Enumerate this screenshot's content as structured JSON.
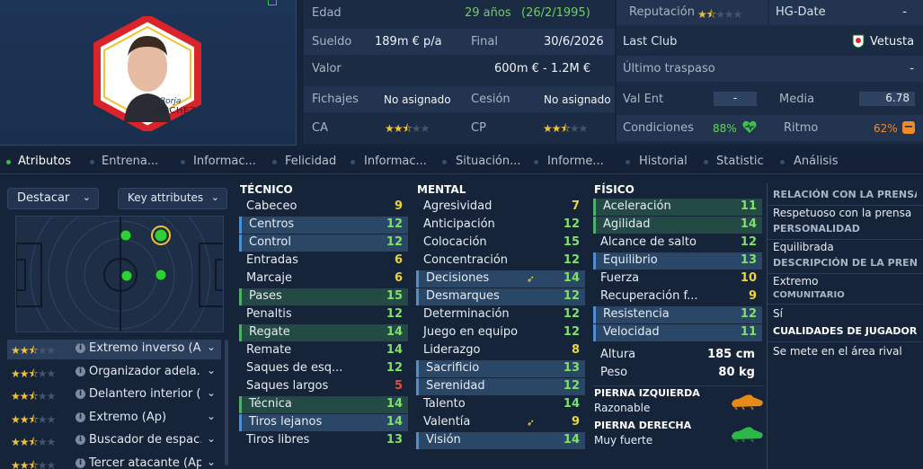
{
  "player": {
    "badge_first": "Borja",
    "badge_last": "SÁNCHEZ"
  },
  "info": {
    "edad_label": "Edad",
    "edad_value": "29 años",
    "birth": "(26/2/1995)",
    "sueldo_label": "Sueldo",
    "sueldo_value": "189m € p/a",
    "final_label": "Final",
    "final_value": "30/6/2026",
    "valor_label": "Valor",
    "valor_value": "600m € - 1.2M €",
    "fichajes_label": "Fichajes",
    "fichajes_value": "No asignado",
    "cesion_label": "Cesión",
    "cesion_value": "No asignado",
    "ca_label": "CA",
    "cp_label": "CP",
    "ca_stars": 2.5,
    "cp_stars": 2.5
  },
  "info2": {
    "reputacion_label": "Reputación",
    "reputacion_stars": 1.5,
    "hg_label": "HG-Date",
    "hg_value": "-",
    "lastclub_label": "Last Club",
    "lastclub_value": "Vetusta",
    "traspaso_label": "Último traspaso",
    "traspaso_value": "-",
    "valent_label": "Val Ent",
    "valent_value": "-",
    "media_label": "Media",
    "media_value": "6.78",
    "condiciones_label": "Condiciones",
    "condiciones_value": "88%",
    "ritmo_label": "Ritmo",
    "ritmo_value": "62%"
  },
  "tabs": [
    "Atributos",
    "Entrena...",
    "Informac...",
    "Felicidad",
    "Informac...",
    "Situación...",
    "Informe...",
    "Historial",
    "Statistic",
    "Análisis"
  ],
  "left": {
    "destacar": "Destacar",
    "key_attributes": "Key attributes",
    "roles": [
      {
        "name": "Extremo inverso (Ap)",
        "stars": 2.5
      },
      {
        "name": "Organizador adela...",
        "stars": 2.5
      },
      {
        "name": "Delantero interior (...",
        "stars": 2.5
      },
      {
        "name": "Extremo (Ap)",
        "stars": 2.5
      },
      {
        "name": "Buscador de espac...",
        "stars": 2.5
      },
      {
        "name": "Tercer atacante (Ap)",
        "stars": 2.5
      }
    ]
  },
  "tecnico": {
    "title": "TÉCNICO",
    "rows": [
      {
        "n": "Cabeceo",
        "v": "9",
        "c": "yellow",
        "hl": false
      },
      {
        "n": "Centros",
        "v": "12",
        "c": "green",
        "hl": true
      },
      {
        "n": "Control",
        "v": "12",
        "c": "green",
        "hl": true
      },
      {
        "n": "Entradas",
        "v": "6",
        "c": "yellow",
        "hl": false
      },
      {
        "n": "Marcaje",
        "v": "6",
        "c": "yellow",
        "hl": false
      },
      {
        "n": "Pases",
        "v": "15",
        "c": "green",
        "hl": "g"
      },
      {
        "n": "Penaltis",
        "v": "12",
        "c": "green",
        "hl": false
      },
      {
        "n": "Regate",
        "v": "14",
        "c": "green",
        "hl": "g"
      },
      {
        "n": "Remate",
        "v": "14",
        "c": "green",
        "hl": false
      },
      {
        "n": "Saques de esq...",
        "v": "12",
        "c": "green",
        "hl": false
      },
      {
        "n": "Saques largos",
        "v": "5",
        "c": "red",
        "hl": false
      },
      {
        "n": "Técnica",
        "v": "14",
        "c": "green",
        "hl": "g"
      },
      {
        "n": "Tiros lejanos",
        "v": "14",
        "c": "green",
        "hl": true
      },
      {
        "n": "Tiros libres",
        "v": "13",
        "c": "green",
        "hl": false
      }
    ]
  },
  "mental": {
    "title": "MENTAL",
    "rows": [
      {
        "n": "Agresividad",
        "v": "7",
        "c": "yellow",
        "hl": false
      },
      {
        "n": "Anticipación",
        "v": "12",
        "c": "green",
        "hl": false
      },
      {
        "n": "Colocación",
        "v": "15",
        "c": "green",
        "hl": false
      },
      {
        "n": "Concentración",
        "v": "12",
        "c": "green",
        "hl": false
      },
      {
        "n": "Decisiones",
        "v": "14",
        "c": "green",
        "hl": true,
        "arrow": true
      },
      {
        "n": "Desmarques",
        "v": "12",
        "c": "green",
        "hl": true
      },
      {
        "n": "Determinación",
        "v": "12",
        "c": "green",
        "hl": false
      },
      {
        "n": "Juego en equipo",
        "v": "12",
        "c": "green",
        "hl": false
      },
      {
        "n": "Liderazgo",
        "v": "8",
        "c": "yellow",
        "hl": false
      },
      {
        "n": "Sacrificio",
        "v": "13",
        "c": "green",
        "hl": true
      },
      {
        "n": "Serenidad",
        "v": "12",
        "c": "green",
        "hl": true
      },
      {
        "n": "Talento",
        "v": "14",
        "c": "green",
        "hl": false
      },
      {
        "n": "Valentía",
        "v": "9",
        "c": "yellow",
        "hl": false,
        "arrow": true
      },
      {
        "n": "Visión",
        "v": "14",
        "c": "green",
        "hl": true
      }
    ]
  },
  "fisico": {
    "title": "FÍSICO",
    "rows": [
      {
        "n": "Aceleración",
        "v": "11",
        "c": "green",
        "hl": "g"
      },
      {
        "n": "Agilidad",
        "v": "14",
        "c": "green",
        "hl": "g"
      },
      {
        "n": "Alcance de salto",
        "v": "12",
        "c": "green",
        "hl": false
      },
      {
        "n": "Equilibrio",
        "v": "13",
        "c": "green",
        "hl": true
      },
      {
        "n": "Fuerza",
        "v": "10",
        "c": "yellow",
        "hl": false
      },
      {
        "n": "Recuperación f...",
        "v": "9",
        "c": "yellow",
        "hl": false
      },
      {
        "n": "Resistencia",
        "v": "12",
        "c": "green",
        "hl": true
      },
      {
        "n": "Velocidad",
        "v": "11",
        "c": "green",
        "hl": true
      }
    ],
    "altura_label": "Altura",
    "altura_value": "185 cm",
    "peso_label": "Peso",
    "peso_value": "80 kg",
    "pierna_izq_label": "PIERNA IZQUIERDA",
    "pierna_izq_value": "Razonable",
    "pierna_der_label": "PIERNA DERECHA",
    "pierna_der_value": "Muy fuerte"
  },
  "side": {
    "rel_h": "RELACIÓN CON LA PRENSA",
    "rel_v": "Respetuoso con la prensa",
    "pers_h": "PERSONALIDAD",
    "pers_v": "Equilibrada",
    "desc_h": "DESCRIPCIÓN DE LA PRENSA",
    "desc_v": "Extremo",
    "com_h": "COMUNITARIO",
    "com_v": "Sí",
    "cual_h": "CUALIDADES DE JUGADOR",
    "cual_v": "Se mete en el área rival"
  },
  "colors": {
    "accent_green": "#3cc24a",
    "star": "#f2c230",
    "attr_green": "#7fe06a",
    "attr_yellow": "#e9d43c",
    "attr_red": "#e0503f"
  }
}
